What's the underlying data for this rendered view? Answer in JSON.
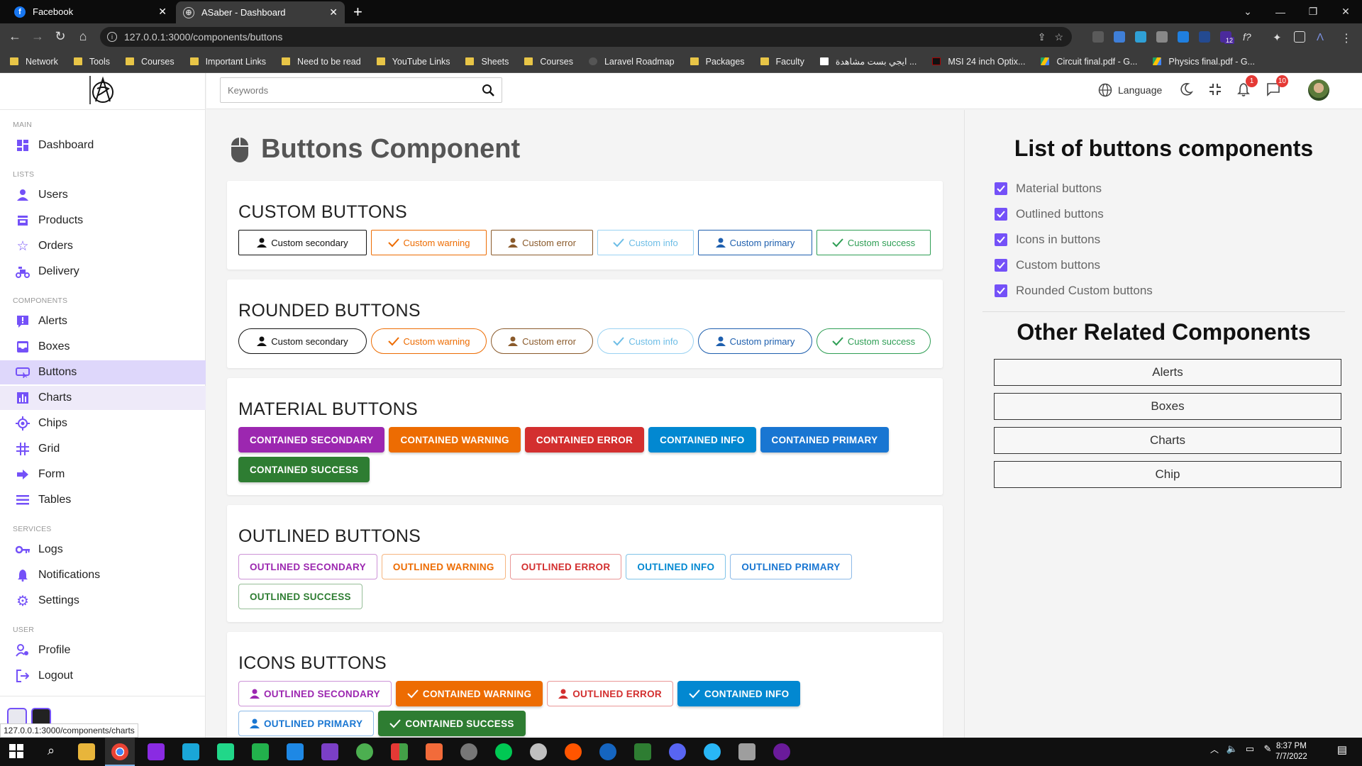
{
  "browser": {
    "tabs": [
      {
        "title": "Facebook"
      },
      {
        "title": "ASaber - Dashboard"
      }
    ],
    "url": "127.0.0.1:3000/components/buttons",
    "bookmarks": [
      "Network",
      "Tools",
      "Courses",
      "Important Links",
      "Need to be read",
      "YouTube Links",
      "Sheets",
      "Courses",
      "Laravel Roadmap",
      "Packages",
      "Faculty",
      "ايجي بست مشاهدة ...",
      "MSI 24 inch Optix...",
      "Circuit final.pdf - G...",
      "Physics final.pdf - G..."
    ],
    "ext_badge": "12",
    "status_url": "127.0.0.1:3000/components/charts"
  },
  "sidebar": {
    "sections": {
      "main": "MAIN",
      "lists": "LISTS",
      "components": "COMPONENTS",
      "services": "SERVICES",
      "user": "USER"
    },
    "items": {
      "dashboard": "Dashboard",
      "users": "Users",
      "products": "Products",
      "orders": "Orders",
      "delivery": "Delivery",
      "alerts": "Alerts",
      "boxes": "Boxes",
      "buttons": "Buttons",
      "charts": "Charts",
      "chips": "Chips",
      "grid": "Grid",
      "form": "Form",
      "tables": "Tables",
      "logs": "Logs",
      "notifications": "Notifications",
      "settings": "Settings",
      "profile": "Profile",
      "logout": "Logout"
    }
  },
  "topbar": {
    "search_placeholder": "Keywords",
    "language": "Language",
    "notif_count": "1",
    "msg_count": "10"
  },
  "page": {
    "title": "Buttons Component",
    "custom": {
      "heading": "CUSTOM BUTTONS",
      "buttons": [
        "Custom secondary",
        "Custom warning",
        "Custom error",
        "Custom info",
        "Custom primary",
        "Custom success"
      ]
    },
    "rounded": {
      "heading": "ROUNDED BUTTONS",
      "buttons": [
        "Custom secondary",
        "Custom warning",
        "Custom error",
        "Custom info",
        "Custom primary",
        "Custom success"
      ]
    },
    "material": {
      "heading": "MATERIAL BUTTONS",
      "buttons": [
        "CONTAINED SECONDARY",
        "CONTAINED WARNING",
        "CONTAINED ERROR",
        "CONTAINED INFO",
        "CONTAINED PRIMARY",
        "CONTAINED SUCCESS"
      ]
    },
    "outlined": {
      "heading": "OUTLINED BUTTONS",
      "buttons": [
        "OUTLINED SECONDARY",
        "OUTLINED WARNING",
        "OUTLINED ERROR",
        "OUTLINED INFO",
        "OUTLINED PRIMARY",
        "OUTLINED SUCCESS"
      ]
    },
    "icons": {
      "heading": "ICONS BUTTONS",
      "buttons": [
        "OUTLINED SECONDARY",
        "CONTAINED WARNING",
        "OUTLINED ERROR",
        "CONTAINED INFO",
        "OUTLINED PRIMARY",
        "CONTAINED SUCCESS"
      ]
    }
  },
  "right": {
    "list_title": "List of buttons components",
    "checks": [
      "Material buttons",
      "Outlined buttons",
      "Icons in buttons",
      "Custom buttons",
      "Rounded Custom buttons"
    ],
    "related_title": "Other Related Components",
    "related": [
      "Alerts",
      "Boxes",
      "Charts",
      "Chip"
    ]
  },
  "taskbar": {
    "time": "8:37 PM",
    "date": "7/7/2022"
  },
  "colors": {
    "accent": "#7451f8",
    "secondary": "#9c27b0",
    "warning": "#ed6c02",
    "error": "#d32f2f",
    "info": "#0288d1",
    "primary": "#1976d2",
    "success": "#2e7d32"
  }
}
